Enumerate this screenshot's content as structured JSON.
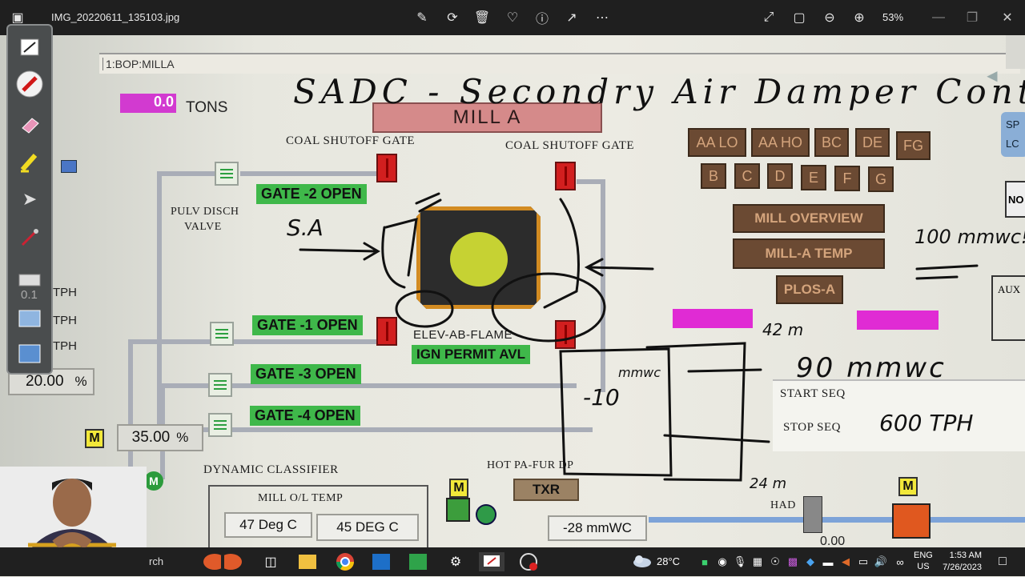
{
  "viewer": {
    "file_name": "IMG_20220611_135103.jpg",
    "zoom": "53%"
  },
  "scada": {
    "tab_label": "1:BOP:MILLA",
    "tons_value": "0.0",
    "tons_unit": "TONS",
    "mill_title": "MILL A",
    "coal_gate_left": "COAL SHUTOFF GATE",
    "coal_gate_right": "COAL SHUTOFF GATE",
    "pulv_disch_valve": [
      "PULV DISCH",
      "VALVE"
    ],
    "gates": [
      "GATE -2 OPEN",
      "GATE -1 OPEN",
      "GATE -3 OPEN",
      "GATE -4 OPEN"
    ],
    "elev_flame": "ELEV-AB-FLAME",
    "ign_permit": "IGN PERMIT AVL",
    "tph_rows": [
      {
        "value": "0.1",
        "unit": "TPH"
      },
      {
        "value": "",
        "unit": "TPH"
      },
      {
        "value": "",
        "unit": "TPH"
      }
    ],
    "pct_value": "20.00",
    "pct_unit": "%",
    "classifier_value": "35.00",
    "classifier_unit": "%",
    "m_label": "M",
    "dynamic_classifier": "DYNAMIC CLASSIFIER",
    "mill_ol_temp": "MILL O/L TEMP",
    "temp1": "47 Deg C",
    "temp2": "45 DEG C",
    "hot_pa": "HOT PA-FUR DP",
    "txr": "TXR",
    "pa_value": "-28 mmWC",
    "elev_row1": [
      "AA LO",
      "AA HO",
      "BC",
      "DE",
      "FG"
    ],
    "elev_row2": [
      "B",
      "C",
      "D",
      "E",
      "F",
      "G"
    ],
    "mill_overview": "MILL OVERVIEW",
    "mill_a_temp": "MILL-A TEMP",
    "plos_a": "PLOS-A",
    "start_seq": "START SEQ",
    "stop_seq": "STOP SEQ",
    "had": "HAD",
    "sp_label": [
      "SP",
      "LC"
    ],
    "no_label": "NO",
    "aux_label": "AUX",
    "partial_value": "0.00"
  },
  "handwriting": {
    "title": "SADC - Secondry Air Damper Control",
    "sa": "S.A",
    "mmwc_100": "100 mmwc!",
    "m42": "42 m",
    "mmwc_90": "90 mmwc",
    "tph_600": "600 TPH",
    "m24": "24 m",
    "minus10": "-10",
    "mmwc_small": "mmwc"
  },
  "taskbar": {
    "search_text": "rch",
    "weather": "28°C",
    "lang": [
      "ENG",
      "US"
    ],
    "time": "1:53 AM",
    "date": "7/26/2023"
  },
  "colors": {
    "gate_green": "#3fb84a",
    "valve_red": "#d21f1f",
    "magenta": "#e02bd4",
    "elev_brown": "#6b4a33",
    "mill_yellow": "#c6d233"
  }
}
